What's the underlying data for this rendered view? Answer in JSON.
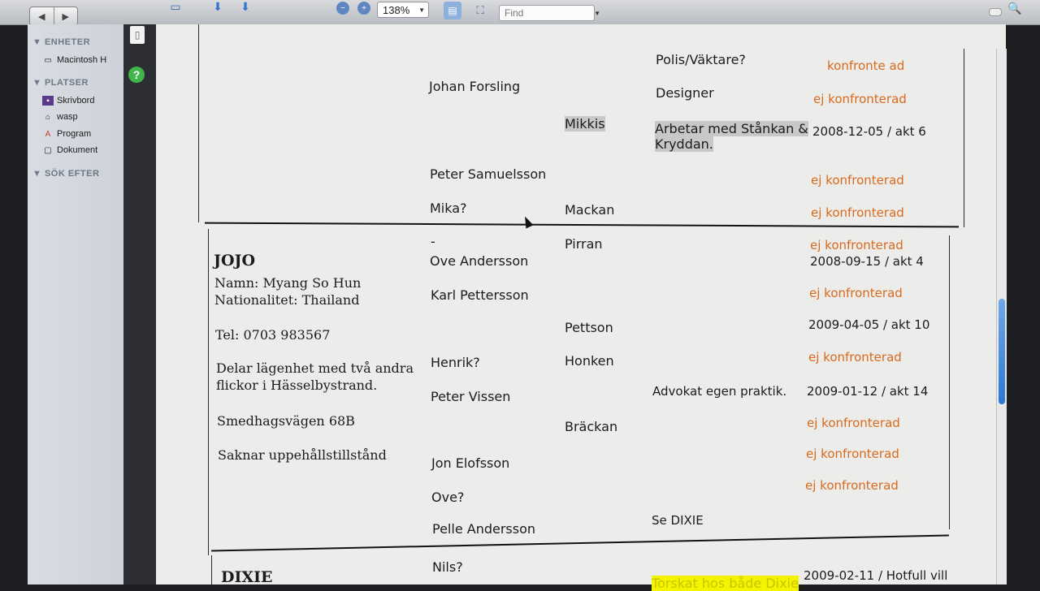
{
  "toolbar": {
    "zoom": "138%",
    "find_placeholder": "Find"
  },
  "sidebar": {
    "sections": [
      {
        "label": "ENHETER",
        "items": [
          "Macintosh H"
        ]
      },
      {
        "label": "PLATSER",
        "items": [
          "Skrivbord",
          "wasp",
          "Program",
          "Dokument"
        ]
      },
      {
        "label": "SÖK EFTER",
        "items": []
      }
    ]
  },
  "table": {
    "row_top": {
      "persons": [
        "Johan Forsling",
        "Peter Samuelsson",
        "Mika?"
      ],
      "aliases": [
        "Mikkis",
        "Mackan"
      ],
      "notes": [
        "Polis/Väktare?",
        "Designer",
        "Arbetar med Stånkan &",
        "Kryddan."
      ],
      "status": [
        "konfronte ad",
        "ej konfronterad",
        "2008-12-05 / akt 6",
        "ej konfronterad",
        "ej konfronterad"
      ]
    },
    "row_jojo": {
      "name": "JOJO",
      "info": [
        "Namn: Myang So Hun",
        "Nationalitet: Thailand",
        "Tel: 0703 983567",
        "Delar lägenhet med två andra flickor i Hässelbystrand.",
        "Smedhagsvägen 68B",
        "Saknar uppehållstillstånd"
      ],
      "persons": [
        "-",
        "Ove Andersson",
        "Karl Pettersson",
        "Henrik?",
        "Peter Vissen",
        "Jon Elofsson",
        "Ove?",
        "Pelle Andersson"
      ],
      "aliases": [
        "Pirran",
        "Pettson",
        "Honken",
        "Bräckan"
      ],
      "notes": [
        "Advokat egen praktik.",
        "Se DIXIE"
      ],
      "status": [
        "ej konfronterad",
        "2008-09-15 / akt 4",
        "ej konfronterad",
        "2009-04-05 / akt 10",
        "ej konfronterad",
        "2009-01-12 / akt 14",
        "ej konfronterad",
        "ej konfronterad",
        "ej konfronterad"
      ]
    },
    "row_dixie": {
      "name": "DIXIE",
      "persons": [
        "Nils?"
      ],
      "notes": [
        "Torskat hos både Dixie"
      ],
      "status": [
        "2009-02-11 / Hotfull vill"
      ]
    }
  },
  "colors": {
    "status_orange": "#d86a1e",
    "highlight_yellow": "#f4f400",
    "highlight_grey": "#c8c8c8"
  }
}
